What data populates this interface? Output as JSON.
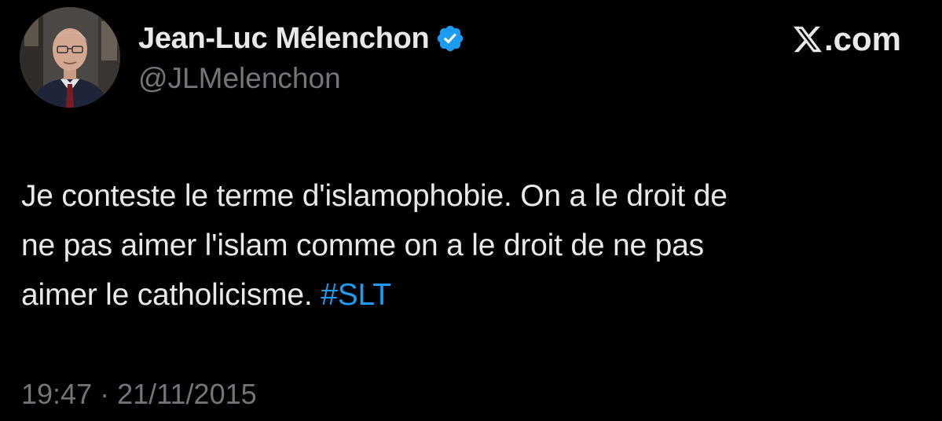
{
  "author": {
    "name": "Jean-Luc Mélenchon",
    "handle": "@JLMelenchon",
    "verified": true
  },
  "brand": {
    "label": ".com",
    "icon": "x-logo-icon"
  },
  "tweet": {
    "lines": [
      "Je conteste le terme d'islamophobie. On a le droit de",
      "ne pas aimer l'islam comme on a le droit de ne pas",
      "aimer le catholicisme."
    ],
    "hashtag": "#SLT"
  },
  "meta": {
    "time": "19:47",
    "separator": "·",
    "date": "21/11/2015"
  },
  "colors": {
    "background": "#000000",
    "text": "#e7e9ea",
    "secondary": "#71767b",
    "accent": "#1d9bf0"
  }
}
